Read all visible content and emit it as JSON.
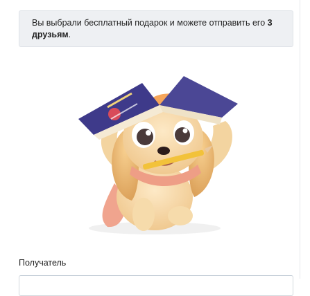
{
  "info": {
    "text_before": "Вы выбрали бесплатный подарок и можете отправить его",
    "text_bold": "3 друзьям",
    "text_after": "."
  },
  "gift": {
    "icon": "puppy-with-book-sticker",
    "book_title_lettering": "УЧЕБНИК"
  },
  "recipient": {
    "label": "Получатель",
    "value": ""
  }
}
